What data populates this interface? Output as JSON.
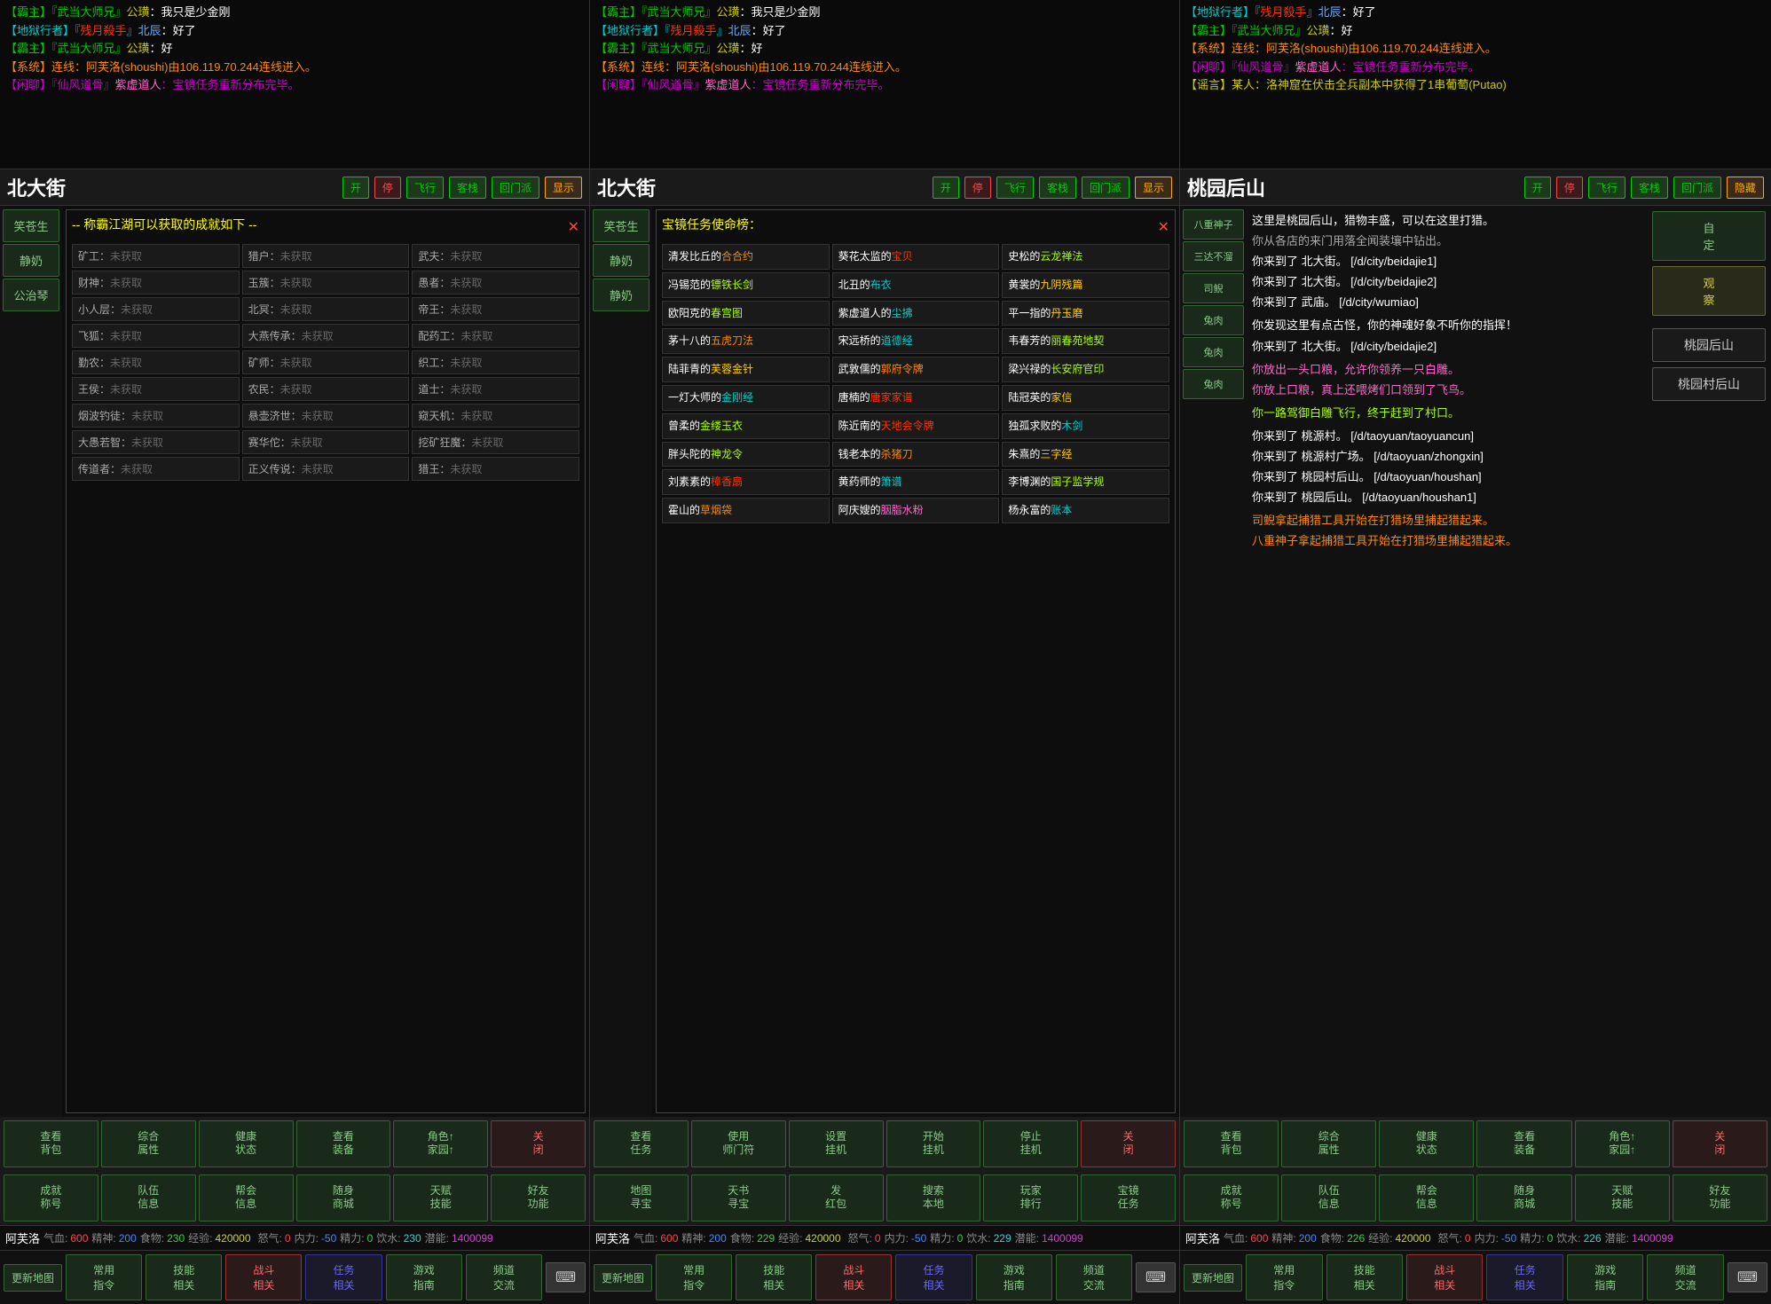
{
  "panels": [
    {
      "id": "panel1",
      "chat": [
        {
          "color": "green",
          "text": "【霸主】『武当大师兄』公璜：我只是少金刚"
        },
        {
          "color": "cyan",
          "text": "【地狱行者】『残月殺手』北辰：好了"
        },
        {
          "color": "green",
          "text": "【霸主】『武当大师兄』公璜：好"
        },
        {
          "color": "red",
          "text": "【系统】连线：阿芙洛(shoushi)由106.119.70.244连线进入。"
        },
        {
          "color": "magenta",
          "text": "【闲聊】『仙风道骨』紫虚道人：宝镜任务重新分布完毕。"
        }
      ],
      "location": "北大街",
      "loc_buttons": [
        "开",
        "停",
        "飞行",
        "客栈",
        "回门派",
        "显示"
      ],
      "sidebar_chars": [
        "笑苍生",
        "静奶",
        "公治琴"
      ],
      "dialog": {
        "type": "achievement",
        "title": "-- 称霸江湖可以获取的成就如下 --",
        "items": [
          {
            "label": "矿工：",
            "status": "未获取"
          },
          {
            "label": "猎户：",
            "status": "未获取"
          },
          {
            "label": "武夫：",
            "status": "未获取"
          },
          {
            "label": "财神：",
            "status": "未获取"
          },
          {
            "label": "玉簇：",
            "status": "未获取"
          },
          {
            "label": "愚者：",
            "status": "未获取"
          },
          {
            "label": "小人层：",
            "status": "未获取"
          },
          {
            "label": "北冥：",
            "status": "未获取"
          },
          {
            "label": "帝王：",
            "status": "未获取"
          },
          {
            "label": "飞狐：",
            "status": "未获取"
          },
          {
            "label": "大燕传承：",
            "status": "未获取"
          },
          {
            "label": "配药工：",
            "status": "未获取"
          },
          {
            "label": "勤农：",
            "status": "未获取"
          },
          {
            "label": "矿师：",
            "status": "未获取"
          },
          {
            "label": "织工：",
            "status": "未获取"
          },
          {
            "label": "王侯：",
            "status": "未获取"
          },
          {
            "label": "农民：",
            "status": "未获取"
          },
          {
            "label": "道士：",
            "status": "未获取"
          },
          {
            "label": "烟波钓徒：",
            "status": "未获取"
          },
          {
            "label": "悬壶济世：",
            "status": "未获取"
          },
          {
            "label": "窥天机：",
            "status": "未获取"
          },
          {
            "label": "大愚若智：",
            "status": "未获取"
          },
          {
            "label": "赛华佗：",
            "status": "未获取"
          },
          {
            "label": "挖矿狂魔：",
            "status": "未获取"
          },
          {
            "label": "传道者：",
            "status": "未获取"
          },
          {
            "label": "正义传说：",
            "status": "未获取"
          },
          {
            "label": "猎王：",
            "status": "未获取"
          }
        ]
      },
      "bottom_buttons1": [
        {
          "label": "查看\n背包",
          "type": "normal"
        },
        {
          "label": "综合\n属性",
          "type": "normal"
        },
        {
          "label": "健康\n状态",
          "type": "normal"
        },
        {
          "label": "查看\n装备",
          "type": "normal"
        },
        {
          "label": "角色↑\n家园↑",
          "type": "normal"
        },
        {
          "label": "关\n闭",
          "type": "red"
        }
      ],
      "bottom_buttons2": [
        {
          "label": "成就\n称号",
          "type": "normal"
        },
        {
          "label": "队伍\n信息",
          "type": "normal"
        },
        {
          "label": "帮会\n信息",
          "type": "normal"
        },
        {
          "label": "随身\n商城",
          "type": "normal"
        },
        {
          "label": "天赋\n技能",
          "type": "normal"
        },
        {
          "label": "好友\n功能",
          "type": "normal"
        }
      ],
      "status": {
        "char": "阿芙洛",
        "hp": 600,
        "mp": 200,
        "food": 230,
        "exp": 420000,
        "rage": 0,
        "neili": -50,
        "stamina": 0,
        "water": 230,
        "potential": 1400099
      },
      "nav": [
        "常用\n指令",
        "技能\n相关",
        "战斗\n相关",
        "任务\n相关",
        "游戏\n指南",
        "频道\n交流"
      ]
    },
    {
      "id": "panel2",
      "chat": [
        {
          "color": "green",
          "text": "【霸主】『武当大师兄』公璜：我只是少金刚"
        },
        {
          "color": "cyan",
          "text": "【地狱行者】『残月殺手』北辰：好了"
        },
        {
          "color": "green",
          "text": "【霸主】『武当大师兄』公璜：好"
        },
        {
          "color": "red",
          "text": "【系统】连线：阿芙洛(shoushi)由106.119.70.244连线进入。"
        },
        {
          "color": "magenta",
          "text": "【闲聊】『仙风道骨』紫虚道人：宝镜任务重新分布完毕。"
        }
      ],
      "location": "北大街",
      "loc_buttons": [
        "开",
        "停",
        "飞行",
        "客栈",
        "回门派",
        "显示"
      ],
      "sidebar_chars": [
        "笑苍生",
        "静奶",
        "静奶"
      ],
      "dialog": {
        "type": "task",
        "title": "宝镜任务使命榜：",
        "items": [
          {
            "person": "清发比丘的合合约",
            "item": "葵花太监的宝贝",
            "person2": "史松的云龙禅法"
          },
          {
            "person": "冯锡范的镖铁长剑",
            "item": "北丑的布衣",
            "person2": "黄裳的九阴残篇"
          },
          {
            "person": "欧阳克的春宫图",
            "item": "紫虚道人的尘拂",
            "person2": "平一指的丹玉磨"
          },
          {
            "person": "茅十八的五虎刀法",
            "item": "宋远桥的道德经",
            "person2": "韦春芳的丽春苑地契"
          },
          {
            "person": "陆菲青的芙蓉金针",
            "item": "武敦儒的郭府令牌",
            "person2": "梁兴禄的长安府官印"
          },
          {
            "person": "一灯大师的金刚经",
            "item": "唐楠的唐家家谱",
            "person2": "陆冠英的家信"
          },
          {
            "person": "曾柔的金缕玉衣",
            "item": "陈近南的天地会令牌",
            "person2": "独孤求败的木剑"
          },
          {
            "person": "胖头陀的神龙令",
            "item": "钱老本的杀猪刀",
            "person2": "朱熹的三字经"
          },
          {
            "person": "刘素素的樟香扇",
            "item": "黄药师的箫谱",
            "person2": "李博渊的国子监学规"
          },
          {
            "person": "霍山的草烟袋",
            "item": "阿庆嫂的胭脂水粉",
            "person2": "杨永富的账本"
          }
        ]
      },
      "bottom_buttons1": [
        {
          "label": "查看\n任务",
          "type": "normal"
        },
        {
          "label": "使用\n师门符",
          "type": "normal"
        },
        {
          "label": "设置\n挂机",
          "type": "normal"
        },
        {
          "label": "开始\n挂机",
          "type": "normal"
        },
        {
          "label": "停止\n挂机",
          "type": "normal"
        },
        {
          "label": "关\n闭",
          "type": "red"
        }
      ],
      "bottom_buttons2": [
        {
          "label": "地图\n寻宝",
          "type": "normal"
        },
        {
          "label": "天书\n寻宝",
          "type": "normal"
        },
        {
          "label": "发\n红包",
          "type": "normal"
        },
        {
          "label": "搜索\n本地",
          "type": "normal"
        },
        {
          "label": "玩家\n排行",
          "type": "normal"
        },
        {
          "label": "宝镜\n任务",
          "type": "active"
        }
      ],
      "status": {
        "char": "阿芙洛",
        "hp": 600,
        "mp": 200,
        "food": 229,
        "exp": 420000,
        "rage": 0,
        "neili": -50,
        "stamina": 0,
        "water": 229,
        "potential": 1400099
      },
      "nav": [
        "常用\n指令",
        "技能\n相关",
        "战斗\n相关",
        "任务\n相关",
        "游戏\n指南",
        "频道\n交流"
      ]
    },
    {
      "id": "panel3",
      "chat_top": [
        {
          "color": "cyan",
          "text": "【地狱行者】『残月殺手』北辰：好了"
        },
        {
          "color": "green",
          "text": "【霸主】『武当大师兄』公璜：好"
        },
        {
          "color": "red",
          "text": "【系统】连线：阿芙洛(shoushi)由106.119.70.244连线进入。"
        },
        {
          "color": "magenta",
          "text": "【闲聊】『仙风道骨』紫虚道人：宝镜任务重新分布完毕。"
        },
        {
          "color": "yellow",
          "text": "【谣言】某人：洛神窟在伏击全兵副本中获得了1串葡萄(Putao)"
        }
      ],
      "location": "桃园后山",
      "loc_buttons": [
        "开",
        "停",
        "飞行",
        "客栈",
        "回门派",
        "隐藏"
      ],
      "main_text": [
        {
          "color": "white",
          "text": "这里是桃园后山，猎物丰盛，可以在这里打猎。"
        },
        {
          "color": "gray",
          "text": "你从各店的来门用落全闻装壤中钻出。"
        },
        {
          "color": "white",
          "text": "你来到了 北大街。 [/d/city/beidajie1]"
        },
        {
          "color": "white",
          "text": "你来到了 北大街。 [/d/city/beidajie2]"
        },
        {
          "color": "white",
          "text": "你来到了 武庙。 [/d/city/wumiao]"
        },
        {
          "color": "white",
          "text": "你发现这里有点古怪，你的神魂好象不听你的指挥！"
        },
        {
          "color": "white",
          "text": "你来到了 北大街。 [/d/city/beidajie2]"
        },
        {
          "color": "pink",
          "text": "你放出一头口粮，允许你领养一只白雕。\n你放上口粮，真上还喂烤们口领到了飞鸟。"
        },
        {
          "color": "lime",
          "text": "你一路驾御白雕飞行，终于赶到了村口。"
        },
        {
          "color": "white",
          "text": "你来到了 桃源村。 [/d/taoyuan/taoyuancun]"
        },
        {
          "color": "white",
          "text": "你来到了 桃源村广场。 [/d/taoyuan/zhongxin]"
        },
        {
          "color": "white",
          "text": "你来到了 桃园村后山。 [/d/taoyuan/houshan]"
        },
        {
          "color": "white",
          "text": "你来到了 桃园后山。 [/d/taoyuan/houshan1]"
        },
        {
          "color": "orange",
          "text": "司鲵拿起捕猎工具开始在打猎场里捕起猎起来。"
        },
        {
          "color": "orange",
          "text": "八重神子拿起捕猎工具开始在打猎场里捕起猎起来。"
        }
      ],
      "right_sidebar": [
        "八重神子",
        "三达不溜",
        "司鲵",
        "兔肉",
        "兔肉",
        "兔肉"
      ],
      "right_controls": [
        {
          "label": "桃园后山",
          "type": "location"
        },
        {
          "label": "桃园村后山",
          "type": "location"
        }
      ],
      "action_buttons": [
        {
          "label": "自\n定",
          "type": "normal"
        },
        {
          "label": "观\n察",
          "type": "normal"
        }
      ],
      "bottom_buttons1": [
        {
          "label": "查看\n背包",
          "type": "normal"
        },
        {
          "label": "综合\n属性",
          "type": "normal"
        },
        {
          "label": "健康\n状态",
          "type": "normal"
        },
        {
          "label": "查看\n装备",
          "type": "normal"
        },
        {
          "label": "角色↑\n家园↑",
          "type": "normal"
        },
        {
          "label": "关\n闭",
          "type": "red"
        }
      ],
      "bottom_buttons2": [
        {
          "label": "成就\n称号",
          "type": "normal"
        },
        {
          "label": "队伍\n信息",
          "type": "normal"
        },
        {
          "label": "帮会\n信息",
          "type": "normal"
        },
        {
          "label": "随身\n商城",
          "type": "normal"
        },
        {
          "label": "天赋\n技能",
          "type": "normal"
        },
        {
          "label": "好友\n功能",
          "type": "normal"
        }
      ],
      "status": {
        "char": "阿芙洛",
        "hp": 600,
        "mp": 200,
        "food": 226,
        "exp": 420000,
        "rage": 0,
        "neili": -50,
        "stamina": 0,
        "water": 226,
        "potential": 1400099
      },
      "nav": [
        "常用\n指令",
        "技能\n相关",
        "战斗\n相关",
        "任务\n相关",
        "游戏\n指南",
        "频道\n交流"
      ]
    }
  ]
}
